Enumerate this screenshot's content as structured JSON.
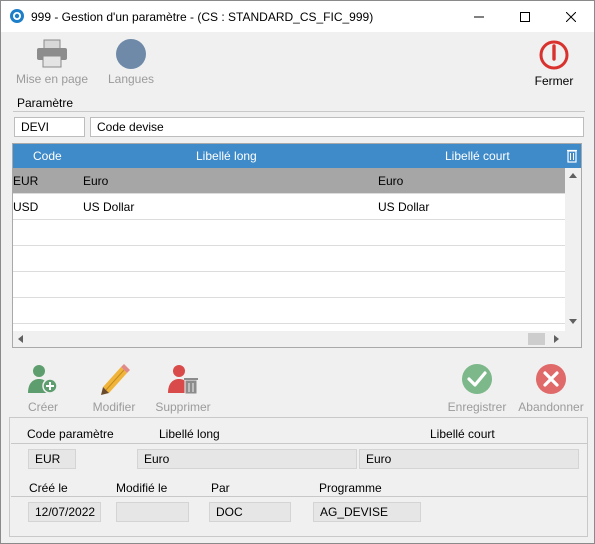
{
  "window": {
    "title": "999 - Gestion d'un paramètre - (CS : STANDARD_CS_FIC_999)",
    "controls": [
      "minimize-icon",
      "maximize-icon",
      "close-icon"
    ]
  },
  "toolbar": {
    "print_label": "Mise en page",
    "languages_label": "Langues",
    "close_label": "Fermer"
  },
  "parameter": {
    "section_label": "Paramètre",
    "code": "DEVI",
    "label": "Code devise"
  },
  "grid": {
    "columns": [
      "Code",
      "Libellé long",
      "Libellé court"
    ],
    "rows": [
      {
        "code": "EUR",
        "long": "Euro",
        "short": "Euro",
        "selected": true
      },
      {
        "code": "USD",
        "long": "US Dollar",
        "short": "US Dollar",
        "selected": false
      }
    ]
  },
  "actions": {
    "create": "Créer",
    "edit": "Modifier",
    "delete": "Supprimer",
    "save": "Enregistrer",
    "cancel": "Abandonner"
  },
  "detail": {
    "code_label": "Code paramètre",
    "long_label": "Libellé long",
    "short_label": "Libellé court",
    "code_value": "EUR",
    "long_value": "Euro",
    "short_value": "Euro",
    "created_label": "Créé le",
    "modified_label": "Modifié le",
    "by_label": "Par",
    "program_label": "Programme",
    "created_value": "12/07/2022",
    "modified_value": "",
    "by_value": "DOC",
    "program_value": "AG_DEVISE"
  },
  "colors": {
    "header_blue": "#3f8ac9",
    "selected_row": "#a6a6a6",
    "create_green": "#5e9e6e",
    "delete_red": "#d94a4a",
    "save_green": "#7cb88a",
    "cancel_red": "#e06a6a",
    "close_red": "#d9322e"
  }
}
